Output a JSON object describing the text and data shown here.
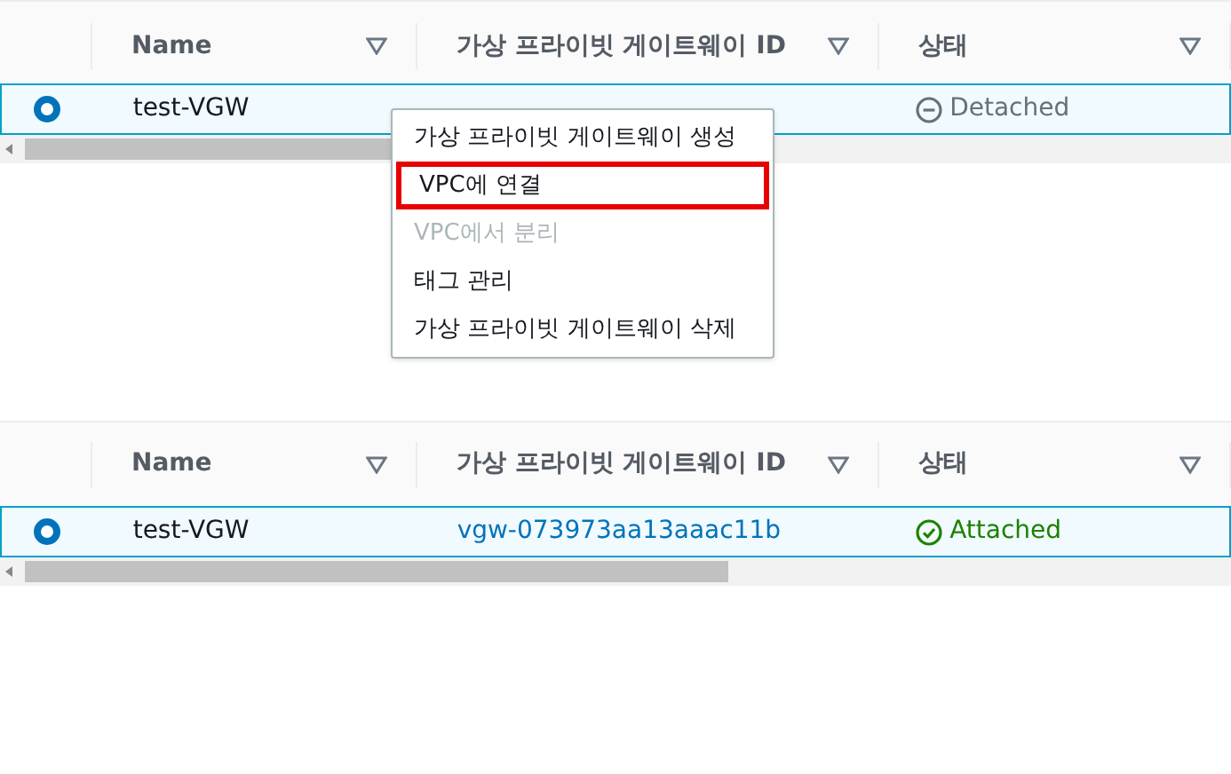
{
  "tables": [
    {
      "columns": [
        {
          "label": "Name"
        },
        {
          "label": "가상 프라이빗 게이트웨이 ID"
        },
        {
          "label": "상태"
        }
      ],
      "rows": [
        {
          "selected": true,
          "name": "test-VGW",
          "status": {
            "kind": "detached",
            "label": "Detached"
          }
        }
      ]
    },
    {
      "columns": [
        {
          "label": "Name"
        },
        {
          "label": "가상 프라이빗 게이트웨이 ID"
        },
        {
          "label": "상태"
        }
      ],
      "rows": [
        {
          "selected": true,
          "name": "test-VGW",
          "id": "vgw-073973aa13aaac11b",
          "status": {
            "kind": "attached",
            "label": "Attached"
          }
        }
      ]
    }
  ],
  "context_menu": {
    "items": [
      {
        "label": "가상 프라이빗 게이트웨이 생성",
        "disabled": false,
        "highlighted": false
      },
      {
        "label": "VPC에 연결",
        "disabled": false,
        "highlighted": true
      },
      {
        "label": "VPC에서 분리",
        "disabled": true,
        "highlighted": false
      },
      {
        "label": "태그 관리",
        "disabled": false,
        "highlighted": false
      },
      {
        "label": "가상 프라이빗 게이트웨이 삭제",
        "disabled": false,
        "highlighted": false
      }
    ]
  }
}
